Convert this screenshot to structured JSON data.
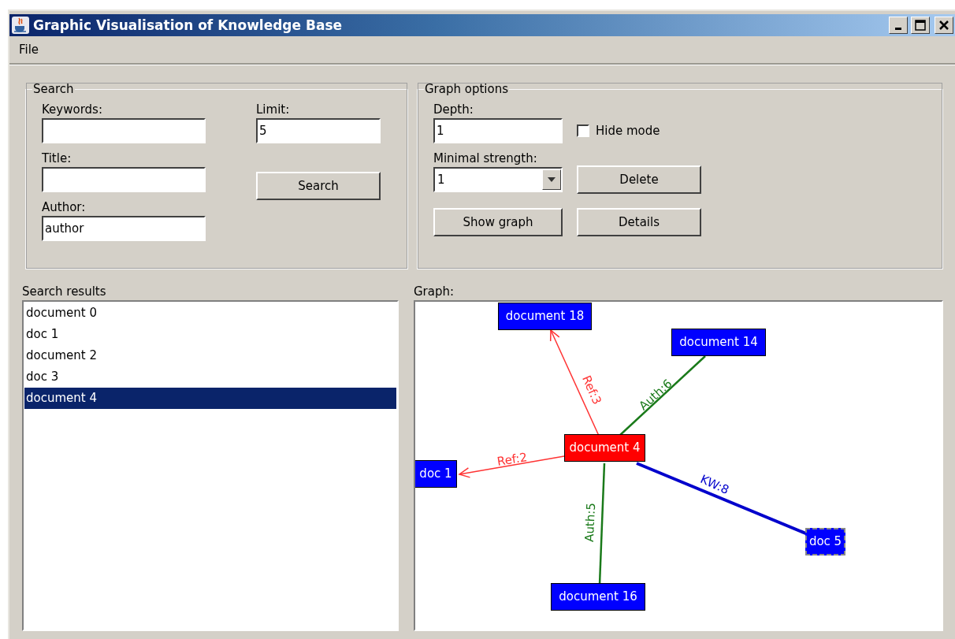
{
  "window": {
    "title": "Graphic Visualisation of Knowledge Base"
  },
  "menu": [
    "File"
  ],
  "search": {
    "legend": "Search",
    "fields": [
      {
        "label": "Keywords:"
      },
      {
        "label": "Title:"
      },
      {
        "label": "Author:",
        "value": "author"
      }
    ],
    "limit": {
      "label": "Limit:",
      "value": "5"
    },
    "button": "Search"
  },
  "graph_options": {
    "legend": "Graph options",
    "depth": {
      "label": "Depth:",
      "value": "1"
    },
    "hide_mode": {
      "label": "Hide mode",
      "checked": false
    },
    "minimal_strength": {
      "label": "Minimal strength:",
      "value": "1"
    },
    "buttons": [
      "Delete",
      "Show graph",
      "Details"
    ]
  },
  "search_results": {
    "label": "Search results",
    "items": [
      {
        "label": "document 0",
        "selected": false
      },
      {
        "label": "doc 1",
        "selected": false
      },
      {
        "label": "document 2",
        "selected": false
      },
      {
        "label": "doc 3",
        "selected": false
      },
      {
        "label": "document 4",
        "selected": true
      }
    ]
  },
  "graph": {
    "label": "Graph:",
    "nodes": [
      {
        "label": "document 18",
        "kind": "document",
        "selected": false
      },
      {
        "label": "document 14",
        "kind": "document",
        "selected": false
      },
      {
        "label": "document 4",
        "kind": "focus",
        "selected": false
      },
      {
        "label": "doc 1",
        "kind": "document",
        "selected": false
      },
      {
        "label": "doc 5",
        "kind": "document",
        "selected": true
      },
      {
        "label": "document 16",
        "kind": "document",
        "selected": false
      }
    ],
    "edges": [
      {
        "label": "Ref:3",
        "kind": "ref"
      },
      {
        "label": "Auth:6",
        "kind": "auth"
      },
      {
        "label": "Ref:2",
        "kind": "ref"
      },
      {
        "label": "Auth:5",
        "kind": "auth"
      },
      {
        "label": "KW:8",
        "kind": "kw"
      }
    ]
  }
}
